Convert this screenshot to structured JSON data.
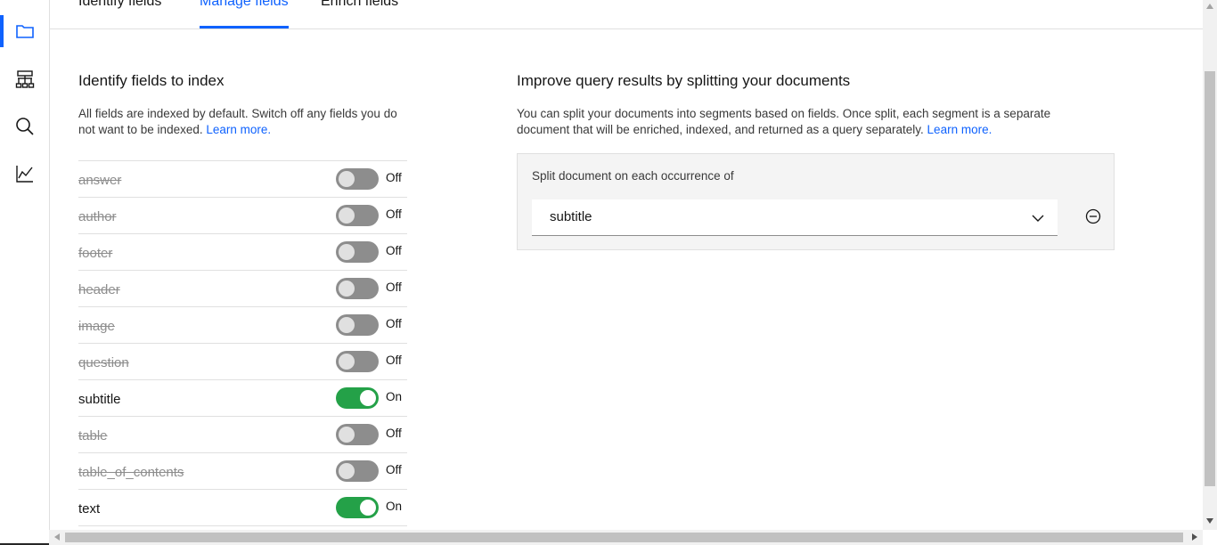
{
  "rail": {
    "items": [
      {
        "icon": "folder-icon",
        "active": true
      },
      {
        "icon": "hierarchy-icon",
        "active": false
      },
      {
        "icon": "search-icon",
        "active": false
      },
      {
        "icon": "line-chart-icon",
        "active": false
      }
    ]
  },
  "tabs": [
    {
      "label": "Identify fields",
      "active": false
    },
    {
      "label": "Manage fields",
      "active": true
    },
    {
      "label": "Enrich fields",
      "active": false
    }
  ],
  "index_section": {
    "title": "Identify fields to index",
    "description": "All fields are indexed by default. Switch off any fields you do not want to be indexed.",
    "learn_more": "Learn more.",
    "fields": [
      {
        "name": "answer",
        "on": false,
        "state": "Off"
      },
      {
        "name": "author",
        "on": false,
        "state": "Off"
      },
      {
        "name": "footer",
        "on": false,
        "state": "Off"
      },
      {
        "name": "header",
        "on": false,
        "state": "Off"
      },
      {
        "name": "image",
        "on": false,
        "state": "Off"
      },
      {
        "name": "question",
        "on": false,
        "state": "Off"
      },
      {
        "name": "subtitle",
        "on": true,
        "state": "On"
      },
      {
        "name": "table",
        "on": false,
        "state": "Off"
      },
      {
        "name": "table_of_contents",
        "on": false,
        "state": "Off"
      },
      {
        "name": "text",
        "on": true,
        "state": "On"
      }
    ]
  },
  "split_section": {
    "title": "Improve query results by splitting your documents",
    "description": "You can split your documents into segments based on fields. Once split, each segment is a separate document that will be enriched, indexed, and returned as a query separately.",
    "learn_more": "Learn more.",
    "panel_label": "Split document on each occurrence of",
    "selected_value": "subtitle"
  },
  "colors": {
    "accent": "#0f62fe",
    "toggle_on": "#24a148",
    "toggle_off": "#8d8d8d"
  }
}
